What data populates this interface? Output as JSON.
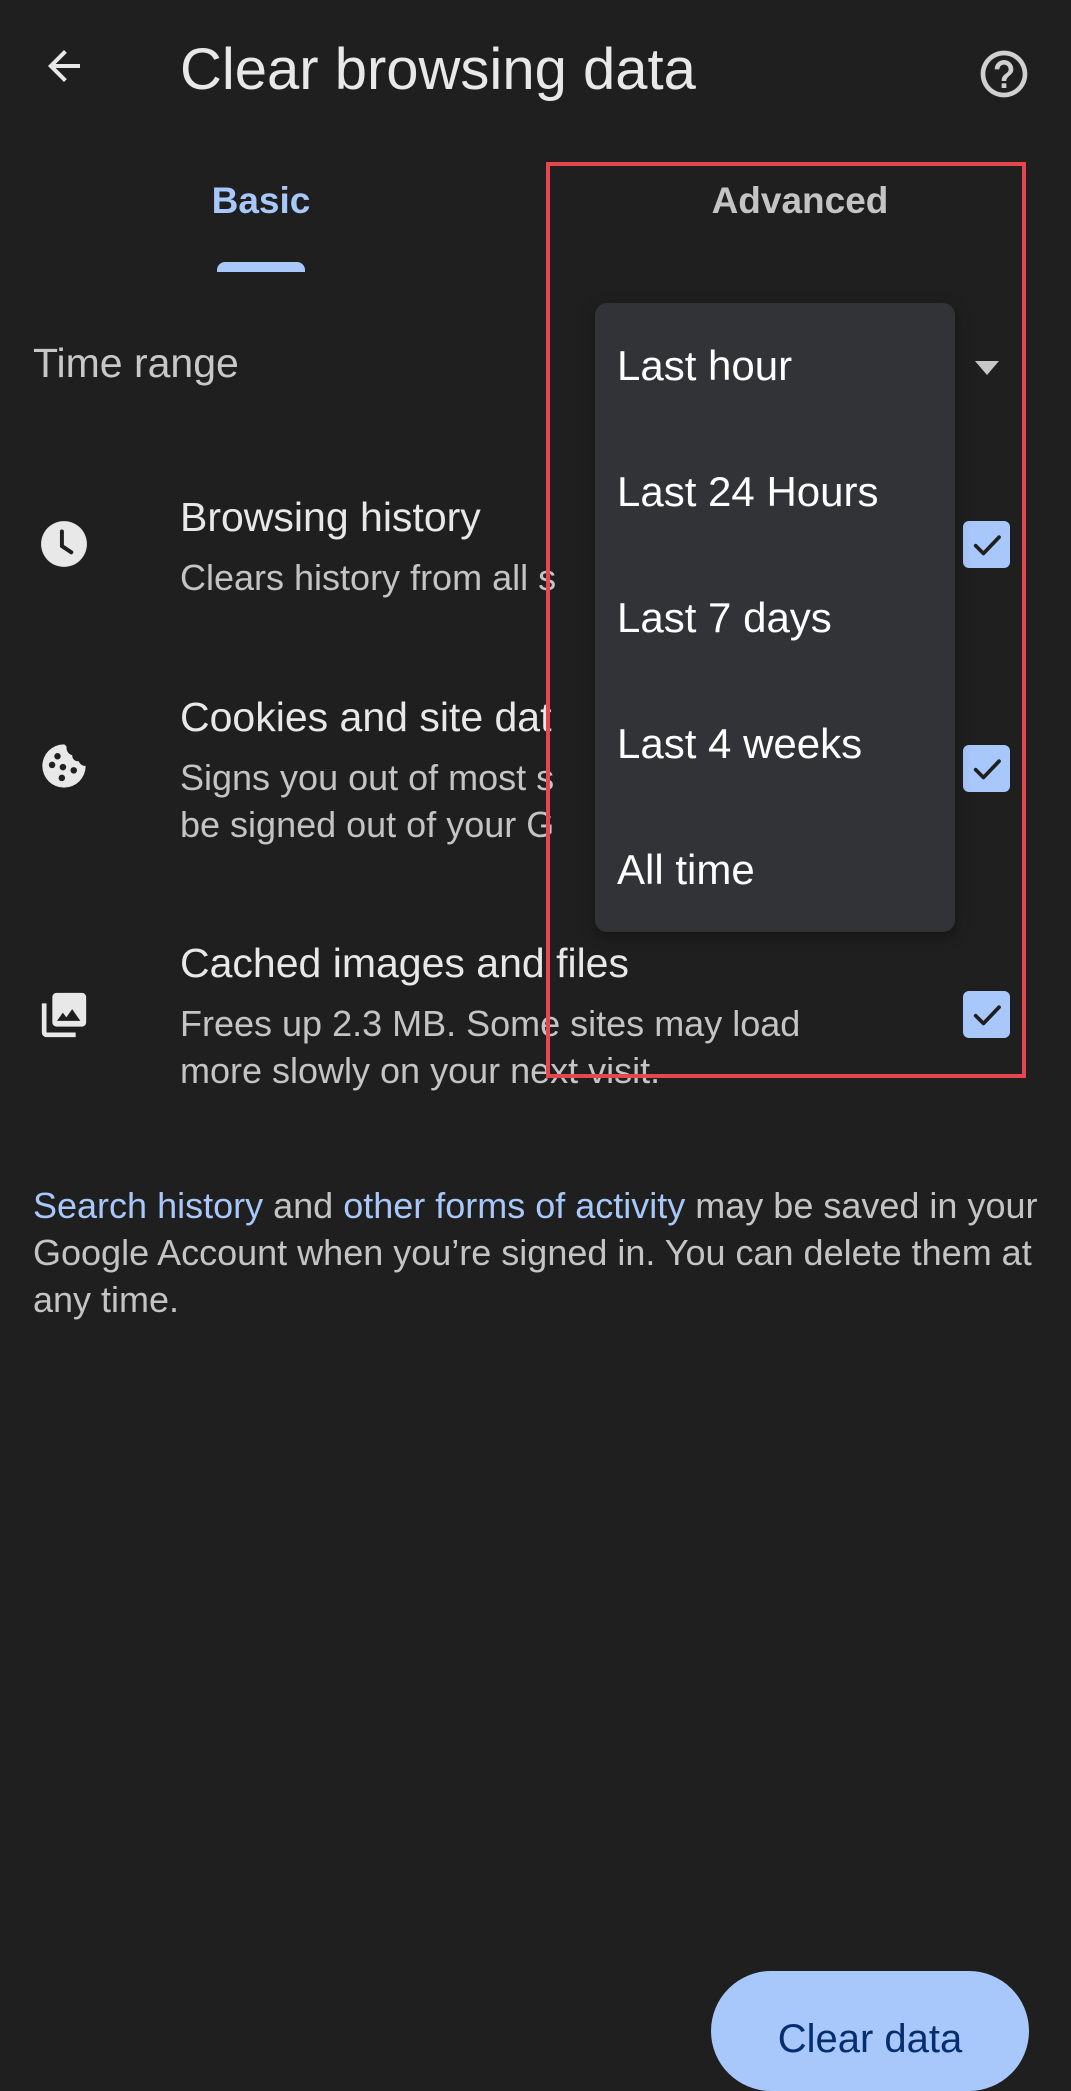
{
  "header": {
    "back_icon": "arrow-back-icon",
    "title": "Clear browsing data",
    "help_icon": "help-circle-icon"
  },
  "tabs": [
    {
      "label": "Basic",
      "selected": true
    },
    {
      "label": "Advanced",
      "selected": false
    }
  ],
  "time_range": {
    "label": "Time range",
    "selected": "Last hour",
    "options": [
      "Last hour",
      "Last 24 Hours",
      "Last 7 days",
      "Last 4 weeks",
      "All time"
    ]
  },
  "items": [
    {
      "icon": "clock-icon",
      "title": "Browsing history",
      "subtitle": "Clears history from all s",
      "checked": true
    },
    {
      "icon": "cookie-icon",
      "title": "Cookies and site dat",
      "subtitle": "Signs you out of most s\nbe signed out of your G",
      "subtitle_line1": "Signs you out of most s",
      "subtitle_line2": "be signed out of your G",
      "checked": true
    },
    {
      "icon": "photo-library-icon",
      "title": "Cached images and files",
      "subtitle_line1": "Frees up 2.3 MB. Some sites may load",
      "subtitle_line2": "more slowly on your next visit.",
      "checked": true
    }
  ],
  "note": {
    "link1": "Search history",
    "text1": " and ",
    "link2": "other forms of activity",
    "text2": " may be saved in your Google Account when you’re signed in. You can delete them at any time."
  },
  "actions": {
    "clear_label": "Clear data"
  },
  "colors": {
    "background": "#1f1f1f",
    "accent": "#a8c7fa",
    "menu_background": "#323336",
    "button_text": "#062e6f",
    "annotation": "#e5464f"
  }
}
